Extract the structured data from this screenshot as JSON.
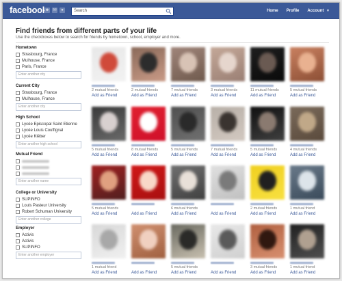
{
  "topbar": {
    "logo": "facebook",
    "search_placeholder": "Search",
    "nav": {
      "home": "Home",
      "profile": "Profile",
      "account": "Account"
    }
  },
  "header": {
    "title": "Find friends from different parts of your life",
    "subtitle": "Use the checkboxes below to search for friends by hometown, school, employer and more."
  },
  "filters": [
    {
      "title": "Hometown",
      "options": [
        "Strasbourg, France",
        "Mulhouse, France",
        "Paris, France"
      ],
      "placeholder": "Enter another city"
    },
    {
      "title": "Current City",
      "options": [
        "Strasbourg, France",
        "Mulhouse, France"
      ],
      "placeholder": "Enter another city"
    },
    {
      "title": "High School",
      "options": [
        "Lycée Episcopal Saint Etienne",
        "Lycée Louis Couffignal",
        "Lycée Kléber"
      ],
      "placeholder": "Enter another high school"
    },
    {
      "title": "Mutual Friend",
      "options": [
        "",
        "",
        ""
      ],
      "placeholder": "Enter another name"
    },
    {
      "title": "College or University",
      "options": [
        "SUPINFO",
        "Louis Pasteur University",
        "Robert Schuman University"
      ],
      "placeholder": "Enter another college"
    },
    {
      "title": "Employer",
      "options": [
        "Activis",
        "Activis",
        "SUPINFO"
      ],
      "placeholder": "Enter another employer"
    }
  ],
  "add_label": "Add as Friend",
  "people": [
    {
      "mutual": "2 mutual friends",
      "colors": [
        "#e8e8e8",
        "#d04a3a",
        "#f2f2f2"
      ]
    },
    {
      "mutual": "2 mutual friends",
      "colors": [
        "#8a6a5a",
        "#2c2c2c",
        "#c99a86"
      ]
    },
    {
      "mutual": "7 mutual friends",
      "colors": [
        "#a0857a",
        "#d8c3b5",
        "#6f5a4d"
      ]
    },
    {
      "mutual": "3 mutual friends",
      "colors": [
        "#c4a898",
        "#e6d6cd",
        "#9a7f74"
      ]
    },
    {
      "mutual": "11 mutual friends",
      "colors": [
        "#1e1e1e",
        "#6a5a52",
        "#0a0a0a"
      ]
    },
    {
      "mutual": "5 mutual friends",
      "colors": [
        "#c98060",
        "#e9b190",
        "#8c4f35"
      ]
    },
    {
      "mutual": "5 mutual friends",
      "colors": [
        "#3a3a3a",
        "#d8d0cf",
        "#6a6a6a"
      ]
    },
    {
      "mutual": "8 mutual friends",
      "colors": [
        "#e02030",
        "#ffffff",
        "#d0102a"
      ]
    },
    {
      "mutual": "5 mutual friends",
      "colors": [
        "#505050",
        "#2a2a2a",
        "#707070"
      ]
    },
    {
      "mutual": "7 mutual friends",
      "colors": [
        "#b8b0a8",
        "#3a3430",
        "#d2c8c0"
      ]
    },
    {
      "mutual": "5 mutual friends",
      "colors": [
        "#101010",
        "#8a7a70",
        "#404040"
      ]
    },
    {
      "mutual": "4 mutual friends",
      "colors": [
        "#7a6a5a",
        "#c0a888",
        "#5a4a3c"
      ]
    },
    {
      "mutual": "5 mutual friends",
      "colors": [
        "#a02020",
        "#e0a080",
        "#502020"
      ]
    },
    {
      "mutual": "",
      "colors": [
        "#d01818",
        "#f8d8c8",
        "#a81010"
      ]
    },
    {
      "mutual": "6 mutual friends",
      "colors": [
        "#707070",
        "#e8e0d8",
        "#404040"
      ]
    },
    {
      "mutual": "",
      "colors": [
        "#e0e0e0",
        "#7a7a7a",
        "#c0c0c0"
      ]
    },
    {
      "mutual": "2 mutual friends",
      "colors": [
        "#f0d020",
        "#202020",
        "#f8e040"
      ]
    },
    {
      "mutual": "1 mutual friend",
      "colors": [
        "#6a7a8a",
        "#dde4ea",
        "#3a4a5a"
      ]
    },
    {
      "mutual": "1 mutual friend",
      "colors": [
        "#d8d8d8",
        "#a8a8a8",
        "#f0f0f0"
      ]
    },
    {
      "mutual": "",
      "colors": [
        "#d09070",
        "#f0d0c0",
        "#a06040"
      ]
    },
    {
      "mutual": "5 mutual friends",
      "colors": [
        "#6a6a60",
        "#2a2a28",
        "#c8c0b0"
      ]
    },
    {
      "mutual": "",
      "colors": [
        "#e8e8e8",
        "#5a5a5a",
        "#d0d0d0"
      ]
    },
    {
      "mutual": "3 mutual friends",
      "colors": [
        "#b06040",
        "#301810",
        "#d89070"
      ]
    },
    {
      "mutual": "1 mutual friend",
      "colors": [
        "#202020",
        "#b0a090",
        "#505050"
      ]
    }
  ]
}
